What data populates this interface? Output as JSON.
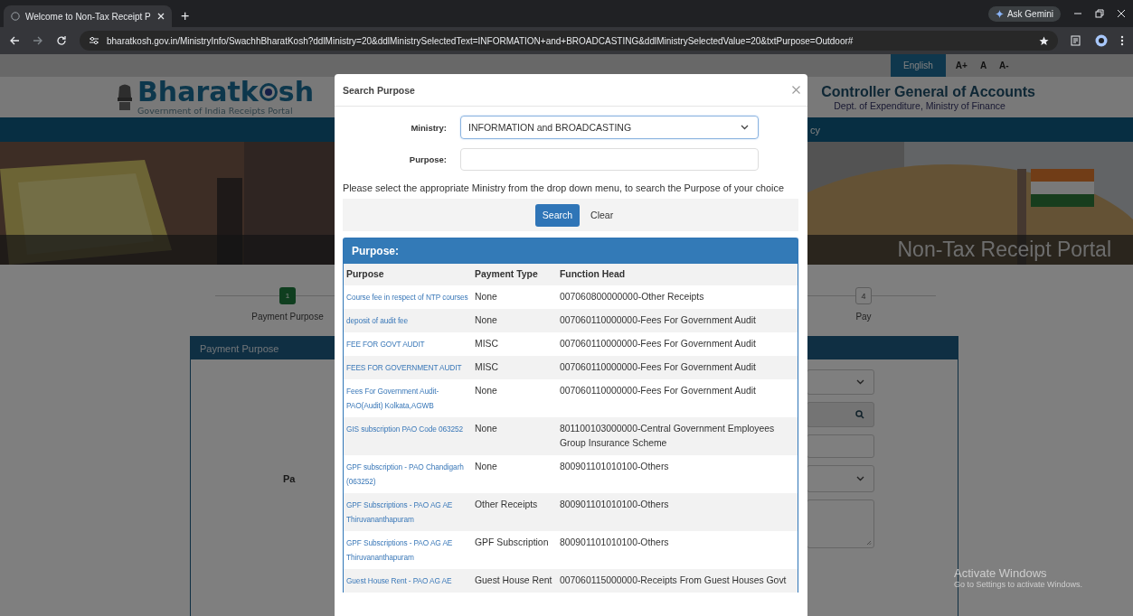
{
  "browser": {
    "tab_title": "Welcome to Non-Tax Receipt P",
    "new_tab": "+",
    "gemini": "Ask Gemini",
    "url": "bharatkosh.gov.in/MinistryInfo/SwachhBharatKosh?ddlMinistry=20&ddlMinistrySelectedText=INFORMATION+and+BROADCASTING&ddlMinistrySelectedValue=20&txtPurpose=Outdoor#"
  },
  "topbar": {
    "language": "English",
    "font_sizes": [
      "A+",
      "A",
      "A-"
    ]
  },
  "header": {
    "logo_start": "Bharatk",
    "logo_end": "sh",
    "tagline": "Government of India Receipts Portal",
    "org_title": "Controller General of Accounts",
    "org_subtitle": "Dept. of Expenditure, Ministry of Finance"
  },
  "nav": {
    "items": [
      "cy"
    ]
  },
  "banner": {
    "caption": "Non-Tax Receipt Portal"
  },
  "steps": [
    {
      "number": "1",
      "label": "Payment Purpose",
      "active": true
    },
    {
      "number": "4",
      "label": "Pay",
      "active": false
    }
  ],
  "panel": {
    "title": "Payment Purpose",
    "label_fragment": "Pa"
  },
  "modal": {
    "title": "Search Purpose",
    "ministry_label": "Ministry:",
    "ministry_value": "INFORMATION and BROADCASTING",
    "purpose_label": "Purpose:",
    "help": "Please select the appropriate Ministry from the drop down menu, to search the Purpose of your choice",
    "search": "Search",
    "clear": "Clear",
    "results_title": "Purpose:",
    "columns": [
      "Purpose",
      "Payment Type",
      "Function Head"
    ],
    "rows": [
      {
        "purpose": "Course fee in respect of NTP courses",
        "payment_type": "None",
        "function_head": "007060800000000-Other Receipts"
      },
      {
        "purpose": "deposit of audit fee",
        "payment_type": "None",
        "function_head": "007060110000000-Fees For Government Audit"
      },
      {
        "purpose": "FEE FOR GOVT AUDIT",
        "payment_type": "MISC",
        "function_head": "007060110000000-Fees For Government Audit"
      },
      {
        "purpose": "FEES FOR GOVERNMENT AUDIT",
        "payment_type": "MISC",
        "function_head": "007060110000000-Fees For Government Audit"
      },
      {
        "purpose": "Fees For Government Audit-PAO(Audit) Kolkata,AGWB",
        "payment_type": "None",
        "function_head": "007060110000000-Fees For Government Audit"
      },
      {
        "purpose": "GIS subscription PAO Code 063252",
        "payment_type": "None",
        "function_head": "801100103000000-Central Government Employees Group Insurance Scheme"
      },
      {
        "purpose": "GPF subscription - PAO Chandigarh (063252)",
        "payment_type": "None",
        "function_head": "800901101010100-Others"
      },
      {
        "purpose": "GPF Subscriptions - PAO AG AE Thiruvananthapuram",
        "payment_type": "Other Receipts",
        "function_head": "800901101010100-Others"
      },
      {
        "purpose": "GPF Subscriptions - PAO AG AE Thiruvananthapuram",
        "payment_type": "GPF Subscription",
        "function_head": "800901101010100-Others"
      },
      {
        "purpose": "Guest House Rent - PAO AG AE",
        "payment_type": "Guest House Rent",
        "function_head": "007060115000000-Receipts From Guest Houses Govt"
      }
    ]
  },
  "os_notice": {
    "title": "Activate Windows",
    "text": "Go to Settings to activate Windows."
  }
}
